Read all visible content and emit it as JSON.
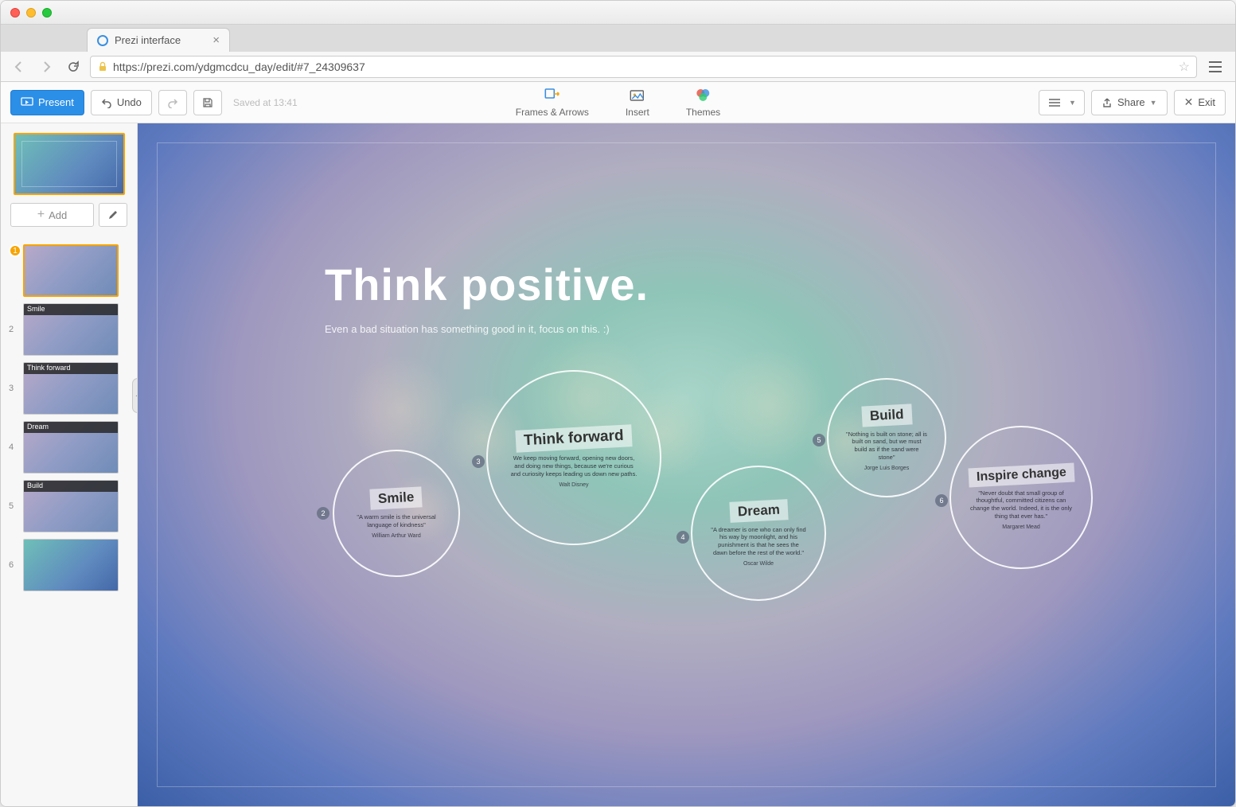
{
  "browser": {
    "tab_title": "Prezi interface",
    "url": "https://prezi.com/ydgmcdcu_day/edit/#7_24309637"
  },
  "toolbar": {
    "present": "Present",
    "undo": "Undo",
    "saved": "Saved at 13:41",
    "frames": "Frames & Arrows",
    "insert": "Insert",
    "themes": "Themes",
    "share": "Share",
    "exit": "Exit"
  },
  "sidebar": {
    "add": "Add",
    "slides": [
      {
        "num": "1",
        "label": ""
      },
      {
        "num": "2",
        "label": "Smile"
      },
      {
        "num": "3",
        "label": "Think forward"
      },
      {
        "num": "4",
        "label": "Dream"
      },
      {
        "num": "5",
        "label": "Build"
      },
      {
        "num": "6",
        "label": ""
      }
    ]
  },
  "canvas": {
    "title": "Think positive.",
    "subtitle": "Even a bad situation has something good in it, focus on this. :)",
    "bubbles": {
      "smile": {
        "n": "2",
        "tag": "Smile",
        "quote": "\"A warm smile is the universal language of kindness\"",
        "author": "William Arthur Ward"
      },
      "think": {
        "n": "3",
        "tag": "Think forward",
        "quote": "We keep moving forward, opening new doors, and doing new things, because we're curious and curiosity keeps leading us down new paths.",
        "author": "Walt Disney"
      },
      "dream": {
        "n": "4",
        "tag": "Dream",
        "quote": "\"A dreamer is one who can only find his way by moonlight, and his punishment is that he sees the dawn before the rest of the world.\"",
        "author": "Oscar Wilde"
      },
      "build": {
        "n": "5",
        "tag": "Build",
        "quote": "\"Nothing is built on stone; all is built on sand, but we must build as if the sand were stone\"",
        "author": "Jorge Luis Borges"
      },
      "inspire": {
        "n": "6",
        "tag": "Inspire change",
        "quote": "\"Never doubt that small group of thoughtful, committed citizens can change the world. Indeed, it is the only thing that ever has.\"",
        "author": "Margaret Mead"
      }
    }
  }
}
